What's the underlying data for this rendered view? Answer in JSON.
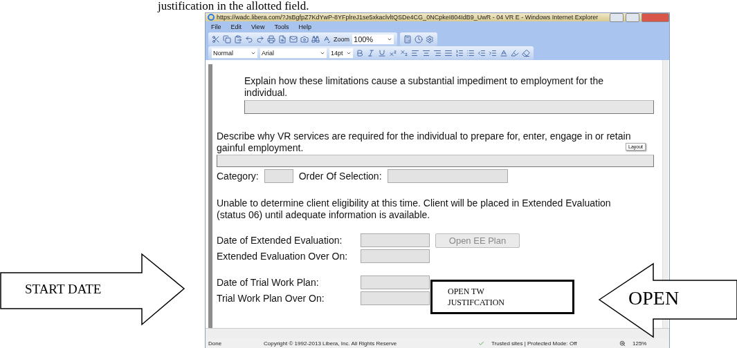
{
  "document_heading": "justification in the allotted field.",
  "window": {
    "title": "https://wadc.libera.com/?JsBgfpZ7KdYwP-8YFplreJ1se5xkaclvltQSDe4CG_0NCpkeI804IdB9_UwR - 04 VR E - Windows Internet Explorer"
  },
  "menu": [
    "File",
    "Edit",
    "View",
    "Tools",
    "Help"
  ],
  "toolbar": {
    "zoom_label": "Zoom",
    "zoom_value": "100%"
  },
  "format_bar": {
    "style": "Normal",
    "font": "Arial",
    "size": "14pt"
  },
  "form": {
    "impediment_question": "Explain how these limitations cause a substantial impediment to employment for the individual.",
    "services_question": "Describe why VR services are required for the individual to prepare for, enter, engage in  or retain gainful employment.",
    "tooltip": "Layout",
    "category_label": "Category:",
    "order_label": "Order Of Selection:",
    "notice": "Unable to determine client eligibility at this time. Client will be placed in Extended Evaluation (status 06) until adequate information is available.",
    "date_rows": [
      {
        "label": "Date of Extended Evaluation:",
        "button": {
          "label": "Open EE Plan",
          "disabled": true
        }
      },
      {
        "label": "Extended Evaluation Over On:"
      },
      {
        "label": "Date of Trial Work Plan:"
      },
      {
        "label": "Trial Work Plan Over On:"
      }
    ]
  },
  "status_bar": {
    "state": "Done",
    "copyright": "Copyright © 1992-2013 Libera, Inc.  All Rights Reserve",
    "security": "Trusted sites | Protected Mode: Off",
    "zoom": "125%"
  },
  "annotations": [
    {
      "kind": "arrow_right",
      "text": "START DATE"
    },
    {
      "kind": "box",
      "text": "OPEN TW JUSTIFCATION"
    },
    {
      "kind": "arrow_left",
      "text": "OPEN"
    }
  ]
}
